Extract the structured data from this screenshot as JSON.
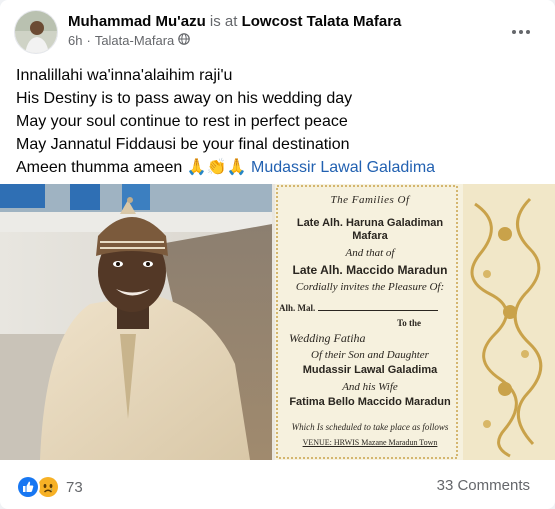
{
  "post": {
    "author": "Muhammad Mu'azu",
    "at_text": "is at",
    "place": "Lowcost Talata Mafara",
    "time": "6h",
    "separator": "·",
    "location": "Talata-Mafara",
    "privacy_icon": "globe-icon",
    "lines": [
      "Innalillahi wa'inna'alaihim raji'u",
      "His Destiny is to pass away on his wedding day",
      "May your soul continue to rest in perfect peace",
      "May Jannatul Fiddausi be your final destination"
    ],
    "last_line_prefix": "Ameen thumma ameen",
    "last_line_emoji": "🙏👏🙏",
    "mention": "Mudassir Lawal Galadima"
  },
  "invitation": {
    "heading": "The Families Of",
    "name1": "Late Alh. Haruna Galadiman Mafara",
    "and_that": "And that of",
    "name2": "Late Alh. Maccido Maradun",
    "cordially": "Cordially invites the Pleasure Of:",
    "alh_mal": "Alh. Mal.",
    "to_the": "To the",
    "event": "Wedding Fatiha",
    "of_their": "Of their Son and Daughter",
    "groom": "Mudassir Lawal Galadima",
    "and_his_wife": "And his Wife",
    "bride": "Fatima Bello Maccido Maradun",
    "scheduled": "Which Is scheduled to take place as follows",
    "venue": "VENUE: HRWIS Mazane Maradun Town"
  },
  "footer": {
    "reaction_icons": [
      "like-icon",
      "sad-icon"
    ],
    "reaction_count": "73",
    "comments": "33 Comments"
  },
  "colors": {
    "like": "#1877f2",
    "sad": "#f7b125",
    "mention": "#2261b1",
    "text_secondary": "#65676b",
    "invite_bg": "#f6f1de",
    "invite_gold": "#c9a24a"
  }
}
